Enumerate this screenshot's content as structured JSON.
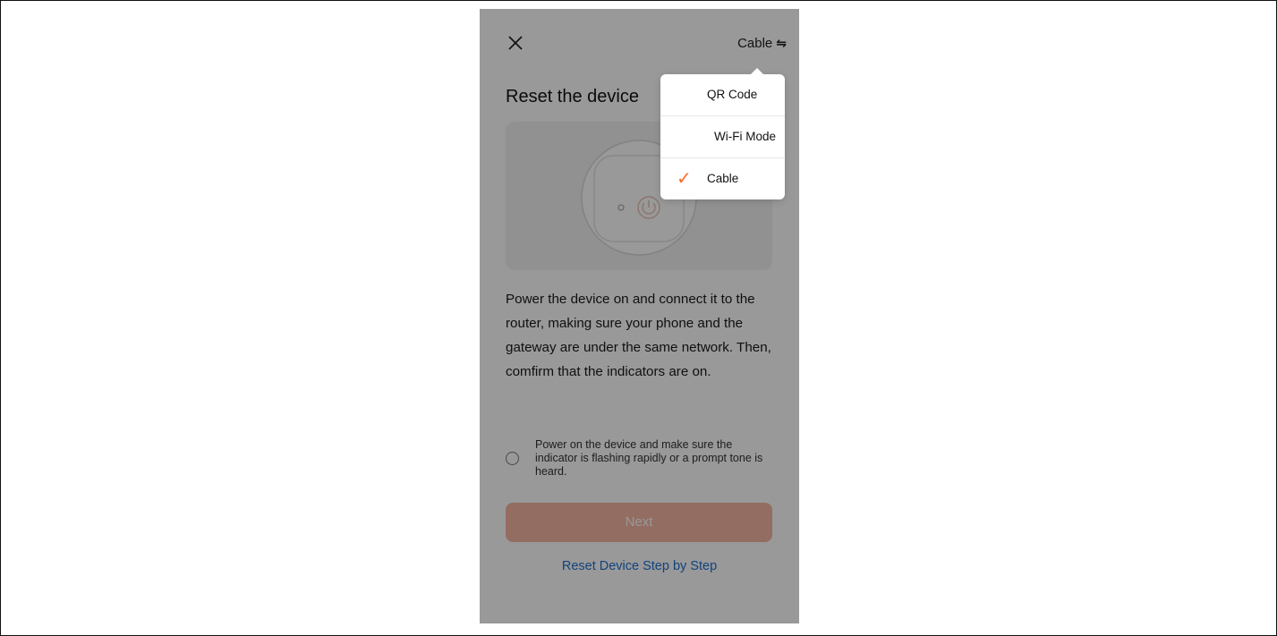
{
  "header": {
    "close_icon": "close-icon",
    "mode_label": "Cable",
    "swap_icon": "⇋"
  },
  "title": "Reset the device",
  "instructions": "Power the device on and connect it to the router, making sure your phone and the gateway are under the same network. Then, comfirm that the indicators are on.",
  "confirm": {
    "checked": false,
    "text": "Power on the device and make sure the indicator is flashing rapidly or a prompt tone is heard."
  },
  "next_label": "Next",
  "step_link": "Reset Device Step by Step",
  "menu": {
    "items": [
      {
        "label": "QR Code",
        "selected": false
      },
      {
        "label": "Wi-Fi Mode",
        "selected": false
      },
      {
        "label": "Cable",
        "selected": true,
        "check_glyph": "✓"
      }
    ]
  },
  "colors": {
    "accent": "#ff6a2b",
    "link": "#1f6fd1",
    "next_disabled": "#f5b6a2"
  }
}
